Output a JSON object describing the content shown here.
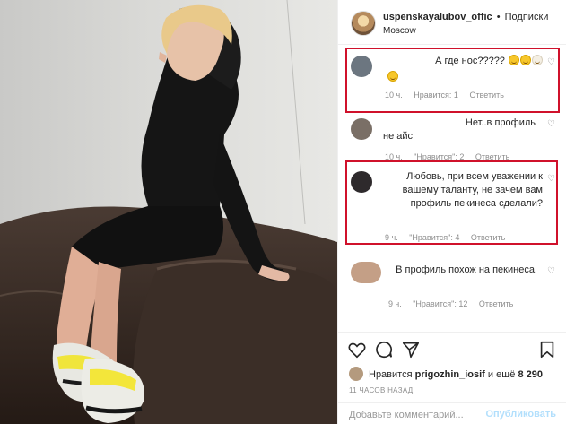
{
  "post": {
    "username": "uspenskayalubov_offic",
    "separator": "•",
    "follow_label": "Подписки",
    "location": "Moscow"
  },
  "comments": [
    {
      "text": "А где нос?????",
      "time": "10 ч.",
      "likes": "Нравится: 1",
      "reply": "Ответить",
      "highlighted": true
    },
    {
      "text": "Нет..в профиль не айс",
      "time": "10 ч.",
      "likes": "\"Нравится\": 2",
      "reply": "Ответить",
      "highlighted": false
    },
    {
      "text": "Любовь, при всем уважении к вашему таланту, не зачем вам профиль пекинеса сделали?",
      "time": "9 ч.",
      "likes": "\"Нравится\": 4",
      "reply": "Ответить",
      "highlighted": true
    },
    {
      "text": "В профиль похож на пекинеса.",
      "time": "9 ч.",
      "likes": "\"Нравится\": 12",
      "reply": "Ответить",
      "highlighted": false
    }
  ],
  "footer": {
    "likes_prefix": "Нравится",
    "likes_user": "prigozhin_iosif",
    "likes_suffix": "и ещё",
    "likes_count": "8 290",
    "timestamp": "11 ЧАСОВ НАЗАД",
    "comment_placeholder": "Добавьте комментарий...",
    "publish_label": "Опубликовать"
  },
  "icons": {
    "like": "heart-icon",
    "comment": "comment-icon",
    "share": "share-icon",
    "save": "bookmark-icon"
  },
  "colors": {
    "highlight_box": "#d0112b",
    "publish_disabled": "#b2dffc",
    "meta_text": "#8e8e8e"
  }
}
